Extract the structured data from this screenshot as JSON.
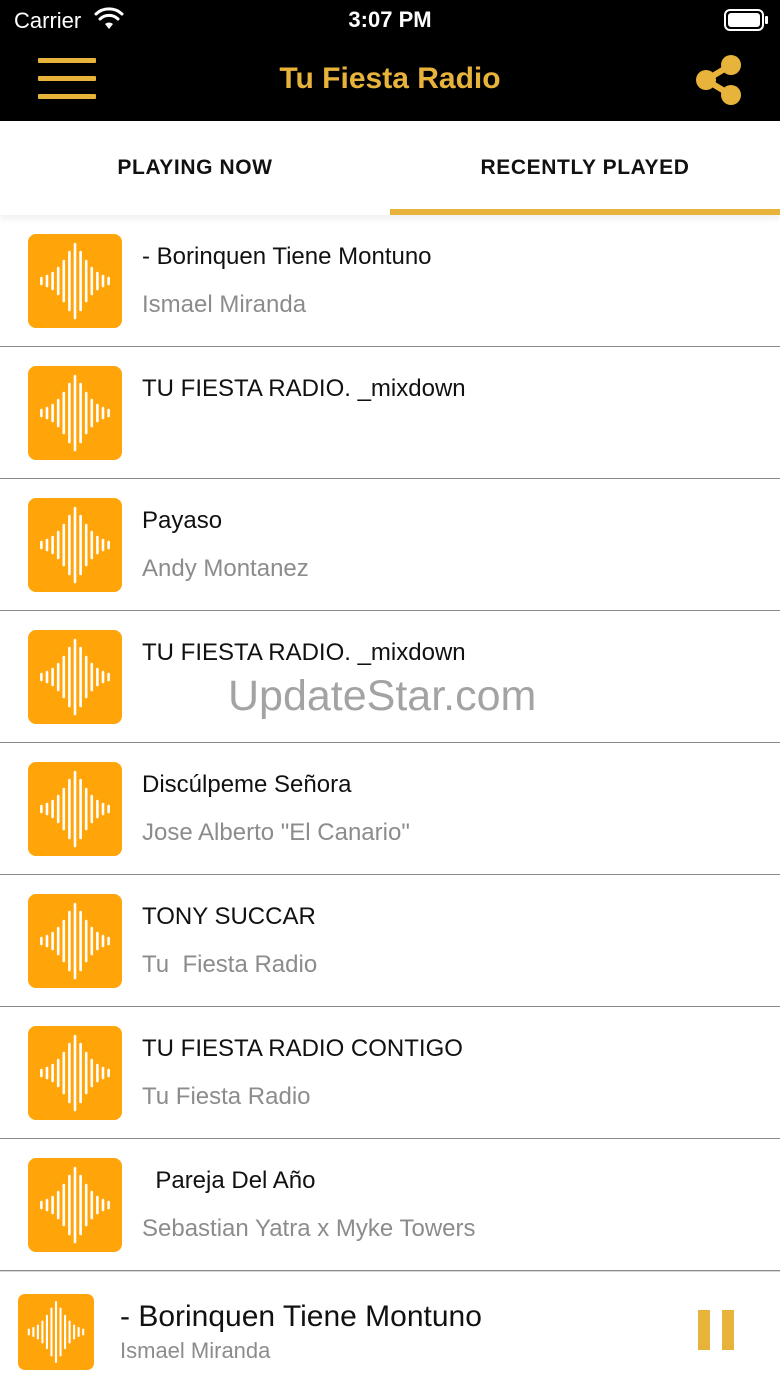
{
  "status_bar": {
    "carrier": "Carrier",
    "time": "3:07 PM"
  },
  "nav": {
    "title": "Tu Fiesta Radio"
  },
  "tabs": [
    {
      "label": "PLAYING NOW"
    },
    {
      "label": "RECENTLY PLAYED",
      "selected": true
    }
  ],
  "colors": {
    "accent": "#E8B33A",
    "artwork": "#FFA50A",
    "bar": "#000000"
  },
  "tracks": [
    {
      "song": "- Borinquen Tiene Montuno",
      "artist": "Ismael Miranda"
    },
    {
      "song": "TU FIESTA RADIO. _mixdown",
      "artist": ""
    },
    {
      "song": "Payaso",
      "artist": "Andy Montanez"
    },
    {
      "song": "TU FIESTA RADIO. _mixdown",
      "artist": ""
    },
    {
      "song": "Discúlpeme Señora",
      "artist": "Jose Alberto \"El Canario\""
    },
    {
      "song": "TONY SUCCAR",
      "artist": "Tu  Fiesta Radio"
    },
    {
      "song": "TU FIESTA RADIO CONTIGO",
      "artist": "Tu Fiesta Radio"
    },
    {
      "song": "  Pareja Del Año",
      "artist": "Sebastian Yatra x Myke Towers"
    }
  ],
  "watermark": "UpdateStar.com",
  "now_playing": {
    "song": "- Borinquen Tiene Montuno",
    "artist": "Ismael Miranda"
  },
  "icons": {
    "menu": "hamburger-icon",
    "share": "share-icon",
    "artwork": "sound-wave-icon",
    "pause": "pause-icon"
  }
}
